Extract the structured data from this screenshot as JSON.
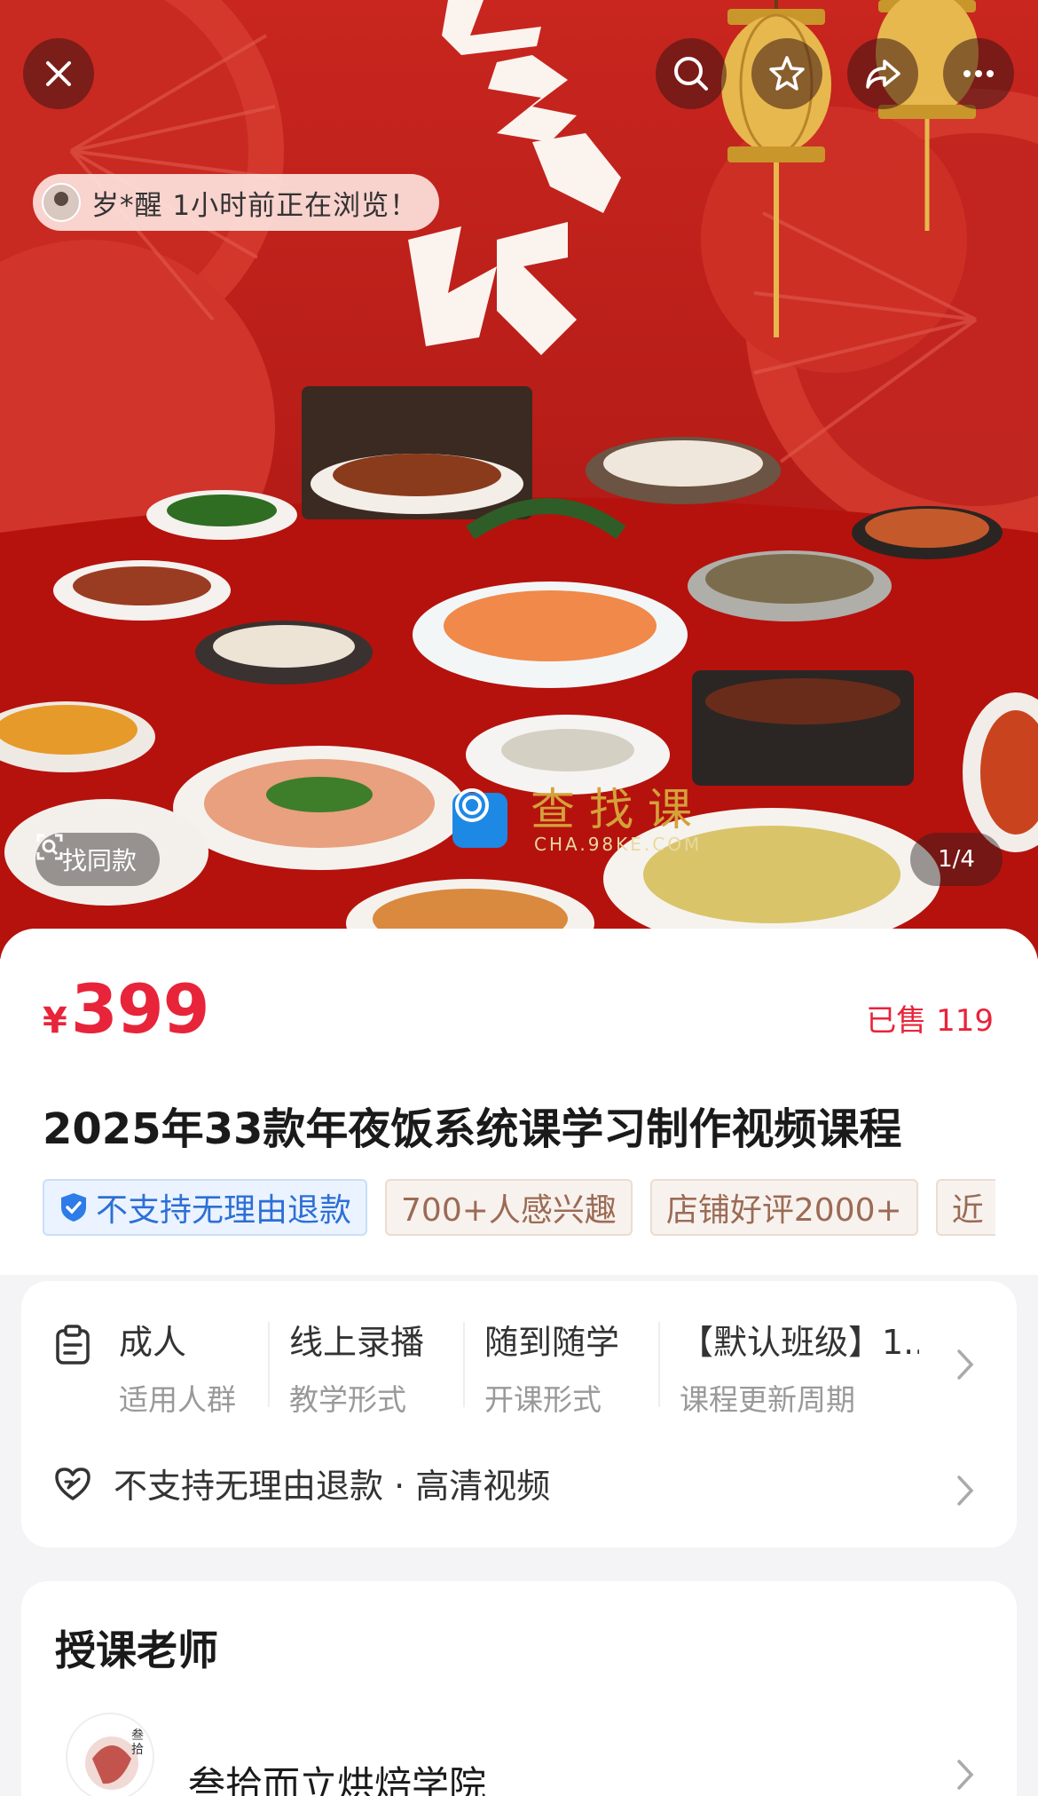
{
  "hero": {
    "top_actions": [
      {
        "name": "close",
        "icon": "close-icon"
      },
      {
        "name": "search",
        "icon": "search-icon"
      },
      {
        "name": "favorite",
        "icon": "star-icon"
      },
      {
        "name": "share",
        "icon": "share-icon"
      },
      {
        "name": "more",
        "icon": "more-icon"
      }
    ],
    "browse_notice": "岁*醒 1小时前正在浏览！",
    "banner_calligraphy": [
      "年",
      "夜",
      "饭"
    ],
    "find_same_label": "找同款",
    "image_counter": "1/4",
    "watermark_title": "查找课",
    "watermark_sub": "CHA.98KE.COM"
  },
  "product": {
    "currency": "¥",
    "price": "399",
    "sold": "已售 119",
    "title": "2025年33款年夜饭系统课学习制作视频课程",
    "tags": [
      {
        "text": "不支持无理由退款",
        "style": "blue",
        "icon": "shield-check-icon"
      },
      {
        "text": "700+人感兴趣",
        "style": "brown"
      },
      {
        "text": "店铺好评2000+",
        "style": "brown"
      },
      {
        "text": "近",
        "style": "brown"
      }
    ]
  },
  "attributes": {
    "icon": "clipboard-icon",
    "items": [
      {
        "value": "成人",
        "label": "适用人群"
      },
      {
        "value": "线上录播",
        "label": "教学形式"
      },
      {
        "value": "随到随学",
        "label": "开课形式"
      },
      {
        "value": "【默认班级】1...",
        "label": "课程更新周期"
      }
    ],
    "service_icon": "heart-shield-icon",
    "service_text": "不支持无理由退款 · 高清视频"
  },
  "teacher": {
    "heading": "授课老师",
    "name": "叁拾而立烘焙学院",
    "avatar_text": "叁拾而立"
  },
  "colors": {
    "accent_red": "#e8243a",
    "banner_red": "#c8261f",
    "tag_blue": "#2d6fd6",
    "tag_brown": "#9b6b55"
  }
}
